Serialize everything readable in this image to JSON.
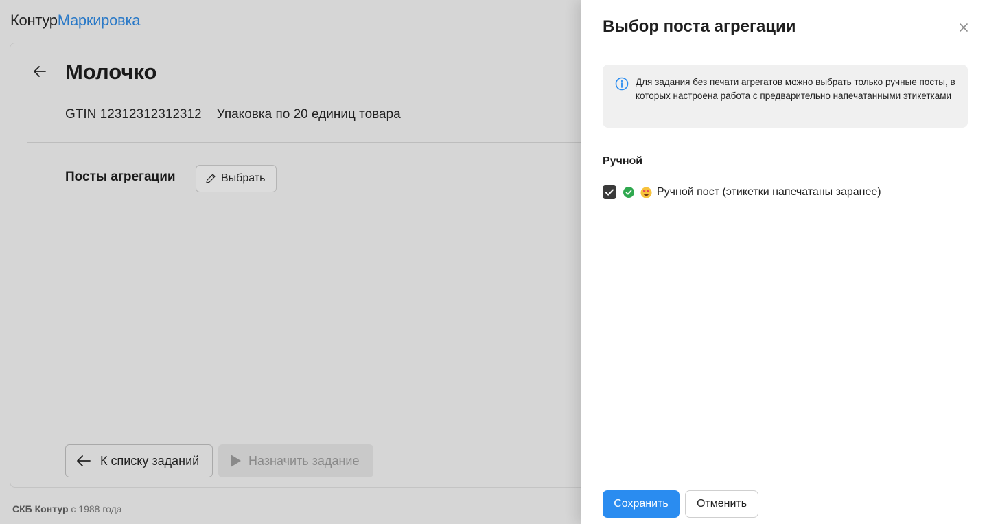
{
  "header": {
    "brand": "Контур",
    "product": "Маркировка"
  },
  "task": {
    "title": "Молочко",
    "gtin": "GTIN 12312312312312",
    "packing": "Упаковка по 20 единиц товара",
    "posts_label": "Посты агрегации",
    "choose_label": "Выбрать"
  },
  "actions": {
    "back_to_list": "К списку заданий",
    "assign": "Назначить задание"
  },
  "footer": {
    "company": "СКБ Контур",
    "since": "с 1988 года"
  },
  "panel": {
    "title": "Выбор поста агрегации",
    "info": "Для задания без печати агрегатов можно выбрать только ручные посты, в которых настроена работа с предварительно напечатанными этикетками",
    "section": "Ручной",
    "options": [
      {
        "label": "Ручной пост (этикетки напечатаны заранее)",
        "checked": true,
        "status_icon": "check-circle-icon",
        "avatar_icon": "heart-eyes-emoji-icon"
      }
    ],
    "save": "Сохранить",
    "cancel": "Отменить"
  },
  "colors": {
    "accent": "#2a8cf0",
    "brand_product": "#2a79c7",
    "status_ok": "#2fa84f"
  }
}
